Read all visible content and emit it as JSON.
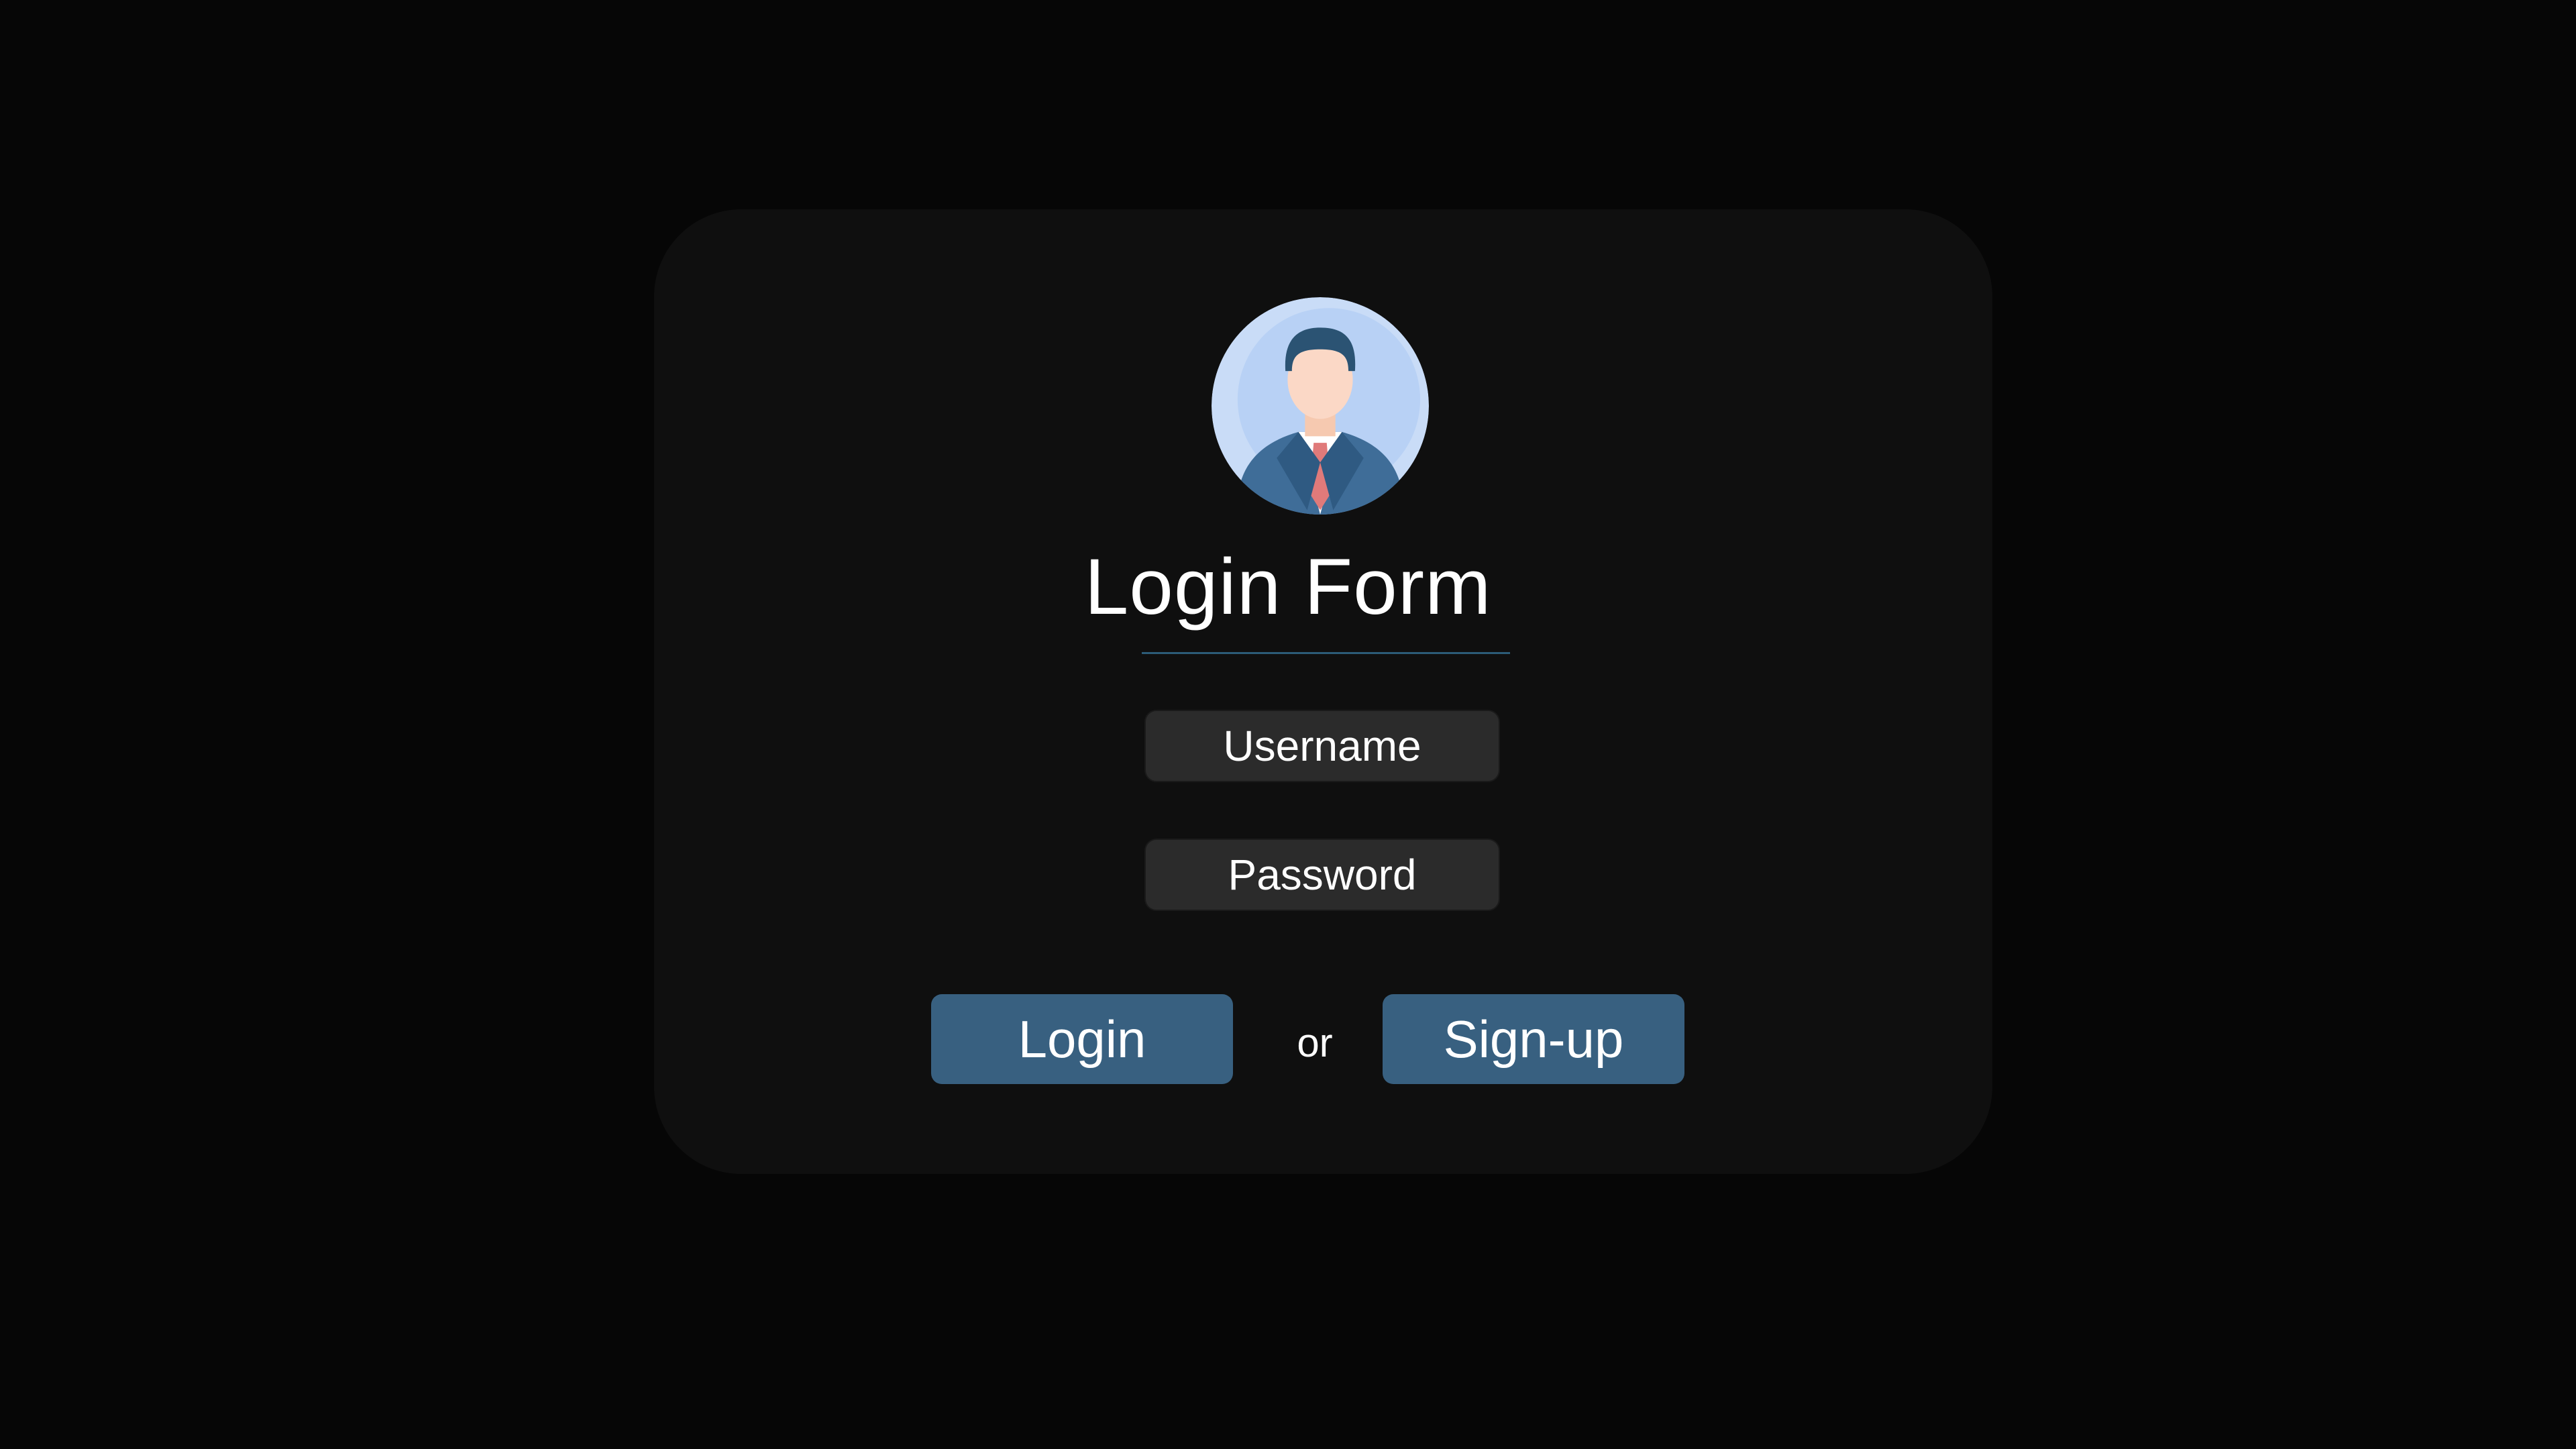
{
  "login_form": {
    "title": "Login Form",
    "username_placeholder": "Username",
    "password_placeholder": "Password",
    "login_label": "Login",
    "separator": "or",
    "signup_label": "Sign-up",
    "avatar_icon": "user-avatar-icon"
  },
  "colors": {
    "background": "#060606",
    "card": "#0f0f0f",
    "field": "#2b2b2b",
    "button": "#386080",
    "underline": "#2c5c78",
    "text": "#ffffff"
  }
}
